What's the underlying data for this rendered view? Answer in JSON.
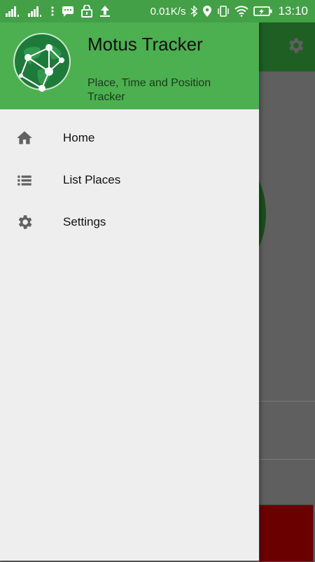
{
  "status_bar": {
    "network_speed": "0.01K/s",
    "time": "13:10"
  },
  "drawer": {
    "app_name": "Motus Tracker",
    "subtitle": "Place, Time and Position Tracker",
    "menu": [
      {
        "label": "Home",
        "icon": "home-icon"
      },
      {
        "label": "List Places",
        "icon": "list-icon"
      },
      {
        "label": "Settings",
        "icon": "gear-icon"
      }
    ]
  },
  "colors": {
    "status_bar": "#43a047",
    "drawer_header": "#4caf50",
    "background_toolbar": "#1f5f23",
    "accent_red": "#6a0000"
  }
}
